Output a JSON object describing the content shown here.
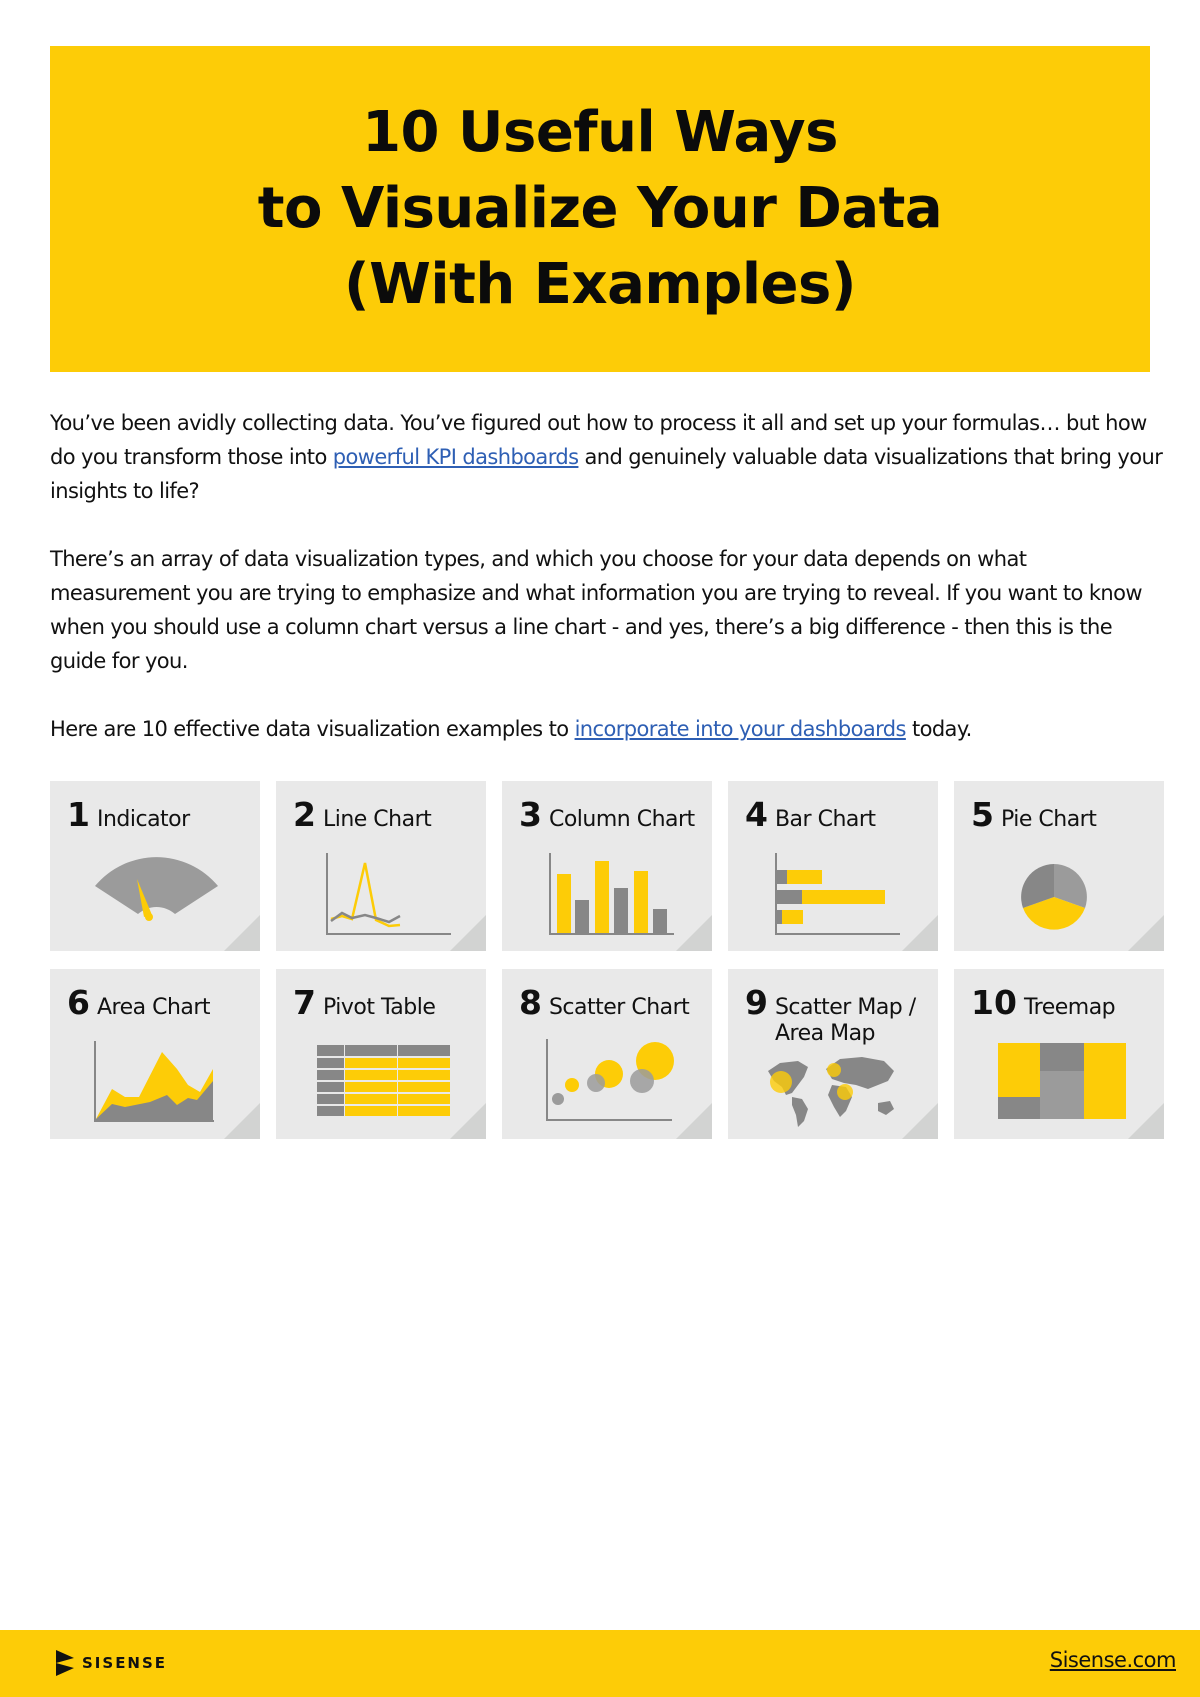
{
  "header": {
    "title_lines": [
      "10 Useful Ways",
      "to Visualize Your Data",
      "(With Examples)"
    ]
  },
  "intro": {
    "p1_before": "You’ve been avidly collecting data. You’ve figured out how to process it all and set up your formulas… but how do you transform those into ",
    "p1_link": "powerful KPI dashboards",
    "p1_after": " and genuinely valuable data visualizations that bring your insights to life?",
    "p2": "There’s an array of data visualization types, and which you choose for your data depends on what measurement you are trying to emphasize and what information you are trying to reveal. If you want to know when you should use a column chart versus a line chart - and yes, there’s a big difference - then this is the guide for you.",
    "p3_before": "Here are 10 effective data visualization examples to ",
    "p3_link": "incorporate into your dashboards",
    "p3_after": " today."
  },
  "colors": {
    "brand_yellow": "#fdcc07",
    "card_bg": "#e9e9e9",
    "gray_dark": "#878787",
    "gray_light": "#9b9b9b",
    "link_blue": "#2e5fb4"
  },
  "cards": [
    {
      "number": "1",
      "label": "Indicator",
      "icon": "gauge-icon"
    },
    {
      "number": "2",
      "label": "Line Chart",
      "icon": "line-chart-icon"
    },
    {
      "number": "3",
      "label": "Column Chart",
      "icon": "column-chart-icon"
    },
    {
      "number": "4",
      "label": "Bar Chart",
      "icon": "bar-chart-icon"
    },
    {
      "number": "5",
      "label": "Pie Chart",
      "icon": "pie-chart-icon"
    },
    {
      "number": "6",
      "label": "Area Chart",
      "icon": "area-chart-icon"
    },
    {
      "number": "7",
      "label": "Pivot Table",
      "icon": "pivot-table-icon"
    },
    {
      "number": "8",
      "label": "Scatter Chart",
      "icon": "scatter-chart-icon"
    },
    {
      "number": "9",
      "label": "Scatter Map / Area Map",
      "icon": "world-map-icon"
    },
    {
      "number": "10",
      "label": "Treemap",
      "icon": "treemap-icon"
    }
  ],
  "footer": {
    "logo_text": "SISENSE",
    "site_link": "Sisense.com"
  }
}
